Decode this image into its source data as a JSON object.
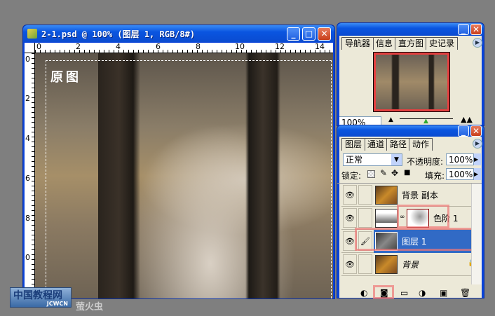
{
  "document": {
    "title": "2-1.psd @ 100% (图层 1, RGB/8#)",
    "ruler_top": [
      "0",
      "2",
      "4",
      "6",
      "8",
      "10",
      "12",
      "14"
    ],
    "ruler_left": [
      "0",
      "2",
      "4",
      "6",
      "8",
      "0"
    ],
    "canvas_text": "原图"
  },
  "navigator": {
    "tabs": [
      "导航器",
      "信息",
      "直方图",
      "史记录"
    ],
    "zoom_value": "100%"
  },
  "layers": {
    "tabs": [
      "图层",
      "通道",
      "路径",
      "动作"
    ],
    "blend_mode": "正常",
    "opacity_label": "不透明度:",
    "opacity_value": "100%",
    "lock_label": "锁定:",
    "fill_label": "填充:",
    "fill_value": "100%",
    "items": [
      {
        "name": "背景 副本",
        "selected": false
      },
      {
        "name": "色阶 1",
        "selected": false
      },
      {
        "name": "图层 1",
        "selected": true
      },
      {
        "name": "背景",
        "selected": false
      }
    ]
  },
  "watermark": {
    "logo": "中国教程网",
    "logo_sub": "JCWCN",
    "author": "萤火虫"
  },
  "colors": {
    "selection": "#316ac5",
    "highlight": "#f08080",
    "titlebar": "#0a55e0"
  }
}
